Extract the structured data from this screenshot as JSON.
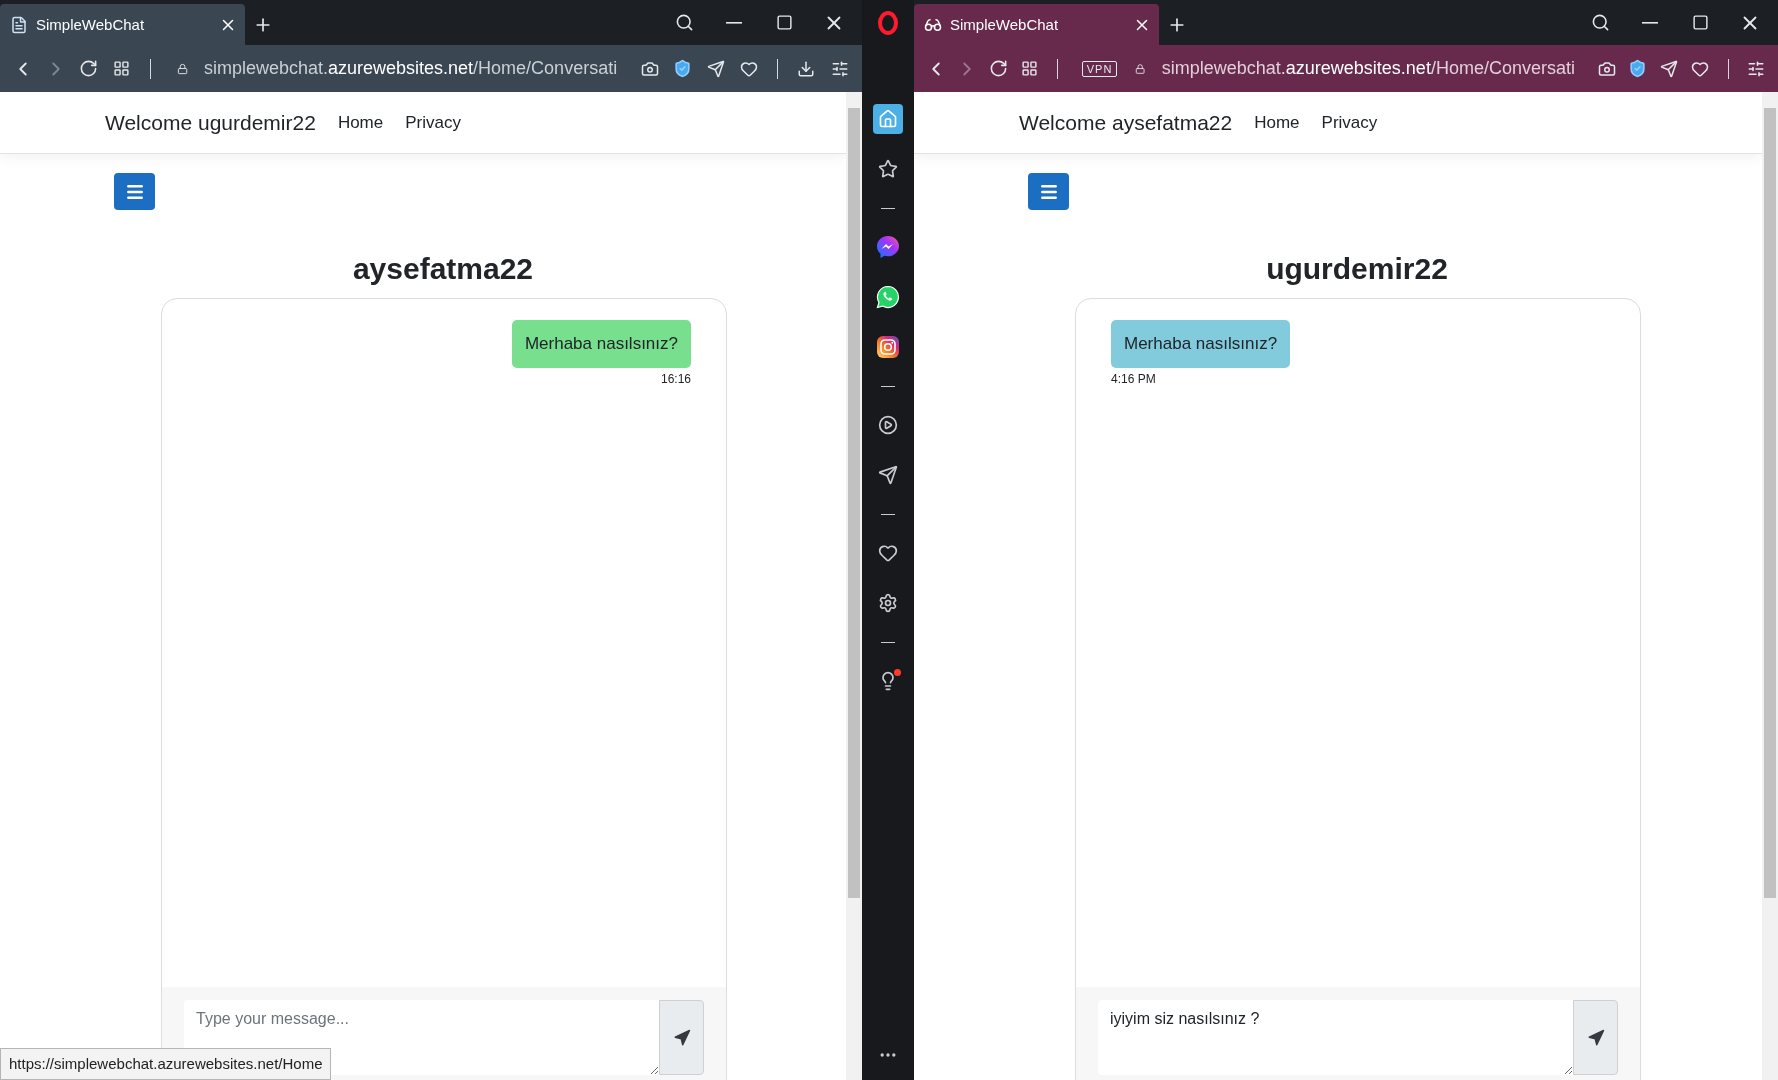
{
  "browsers": [
    {
      "private": false,
      "tab": {
        "title": "SimpleWebChat"
      },
      "address": "simplewebchat.**azurewebsites.net**/Home/Conversati",
      "download_button": true,
      "page": {
        "welcome": "Welcome ugurdemir22",
        "nav": [
          {
            "label": "Home"
          },
          {
            "label": "Privacy"
          }
        ],
        "chat_title": "aysefatma22",
        "messages": [
          {
            "text": "Merhaba nasılsınız?",
            "time": "16:16",
            "outgoing": true
          }
        ],
        "composer": {
          "placeholder": "Type your message..."
        }
      },
      "status_link": "https://simplewebchat.azurewebsites.net/Home"
    },
    {
      "private": true,
      "tab": {
        "title": "SimpleWebChat"
      },
      "vpn_badge": "VPN",
      "address": "simplewebchat.**azurewebsites.net**/Home/Conversati",
      "download_button": false,
      "page": {
        "welcome": "Welcome aysefatma22",
        "nav": [
          {
            "label": "Home"
          },
          {
            "label": "Privacy"
          }
        ],
        "chat_title": "ugurdemir22",
        "messages": [
          {
            "text": "Merhaba nasılsınız?",
            "time": "4:16 PM",
            "outgoing": false
          }
        ],
        "composer": {
          "value": "iyiyim siz nasılsınız ?"
        }
      }
    }
  ],
  "sidebar": {
    "tips_notification": true
  }
}
